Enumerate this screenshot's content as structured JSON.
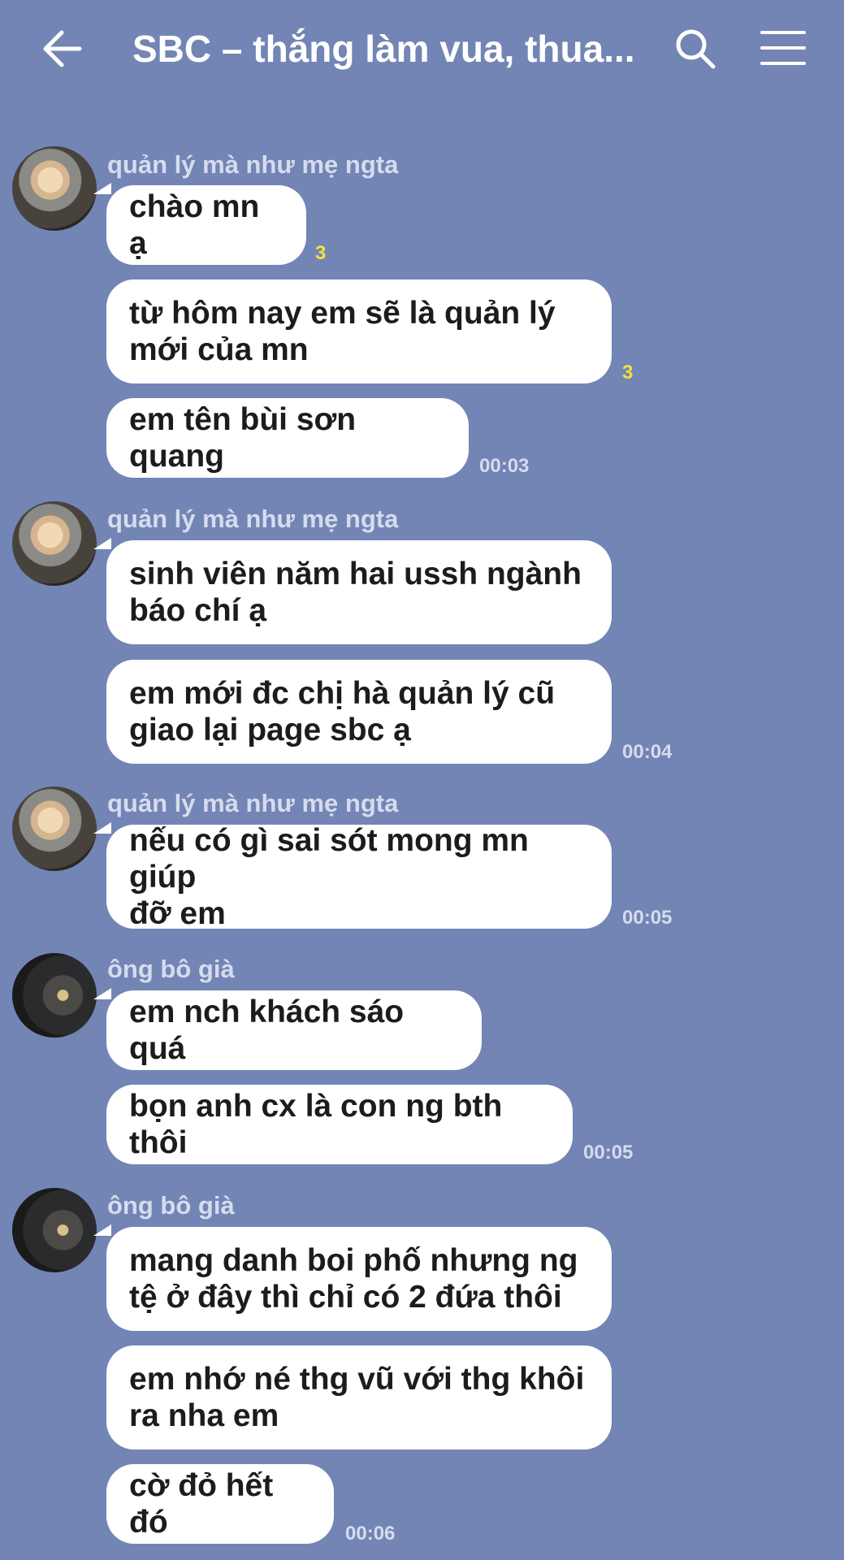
{
  "header": {
    "title": "SBC – thắng làm vua, thua...",
    "back_icon": "back-arrow-icon",
    "search_icon": "search-icon",
    "menu_icon": "menu-icon"
  },
  "messages": [
    {
      "sender": "quản lý mà như mẹ ngta",
      "bubbles": [
        "chào mn ạ",
        "từ hôm nay em sẽ là quản lý\nmới của mn",
        "em tên bùi sơn quang"
      ],
      "read_counts": [
        "3",
        "3"
      ],
      "time": "00:03"
    },
    {
      "sender": "quản lý mà như mẹ ngta",
      "bubbles": [
        "sinh viên năm hai ussh ngành\nbáo chí ạ",
        "em mới đc chị hà quản lý cũ\ngiao lại page sbc ạ"
      ],
      "time": "00:04"
    },
    {
      "sender": "quản lý mà như mẹ ngta",
      "bubbles": [
        "nếu có gì sai sót mong mn giúp\nđỡ em"
      ],
      "time": "00:05"
    },
    {
      "sender": "ông bô già",
      "bubbles": [
        "em nch khách sáo quá",
        "bọn anh cx là con ng bth thôi"
      ],
      "time": "00:05"
    },
    {
      "sender": "ông bô già",
      "bubbles": [
        "mang danh boi phố nhưng ng\ntệ ở đây thì chỉ có 2 đứa thôi",
        "em nhớ né thg vũ với thg khôi\nra nha em",
        "cờ đỏ hết đó"
      ],
      "time": "00:06"
    }
  ]
}
